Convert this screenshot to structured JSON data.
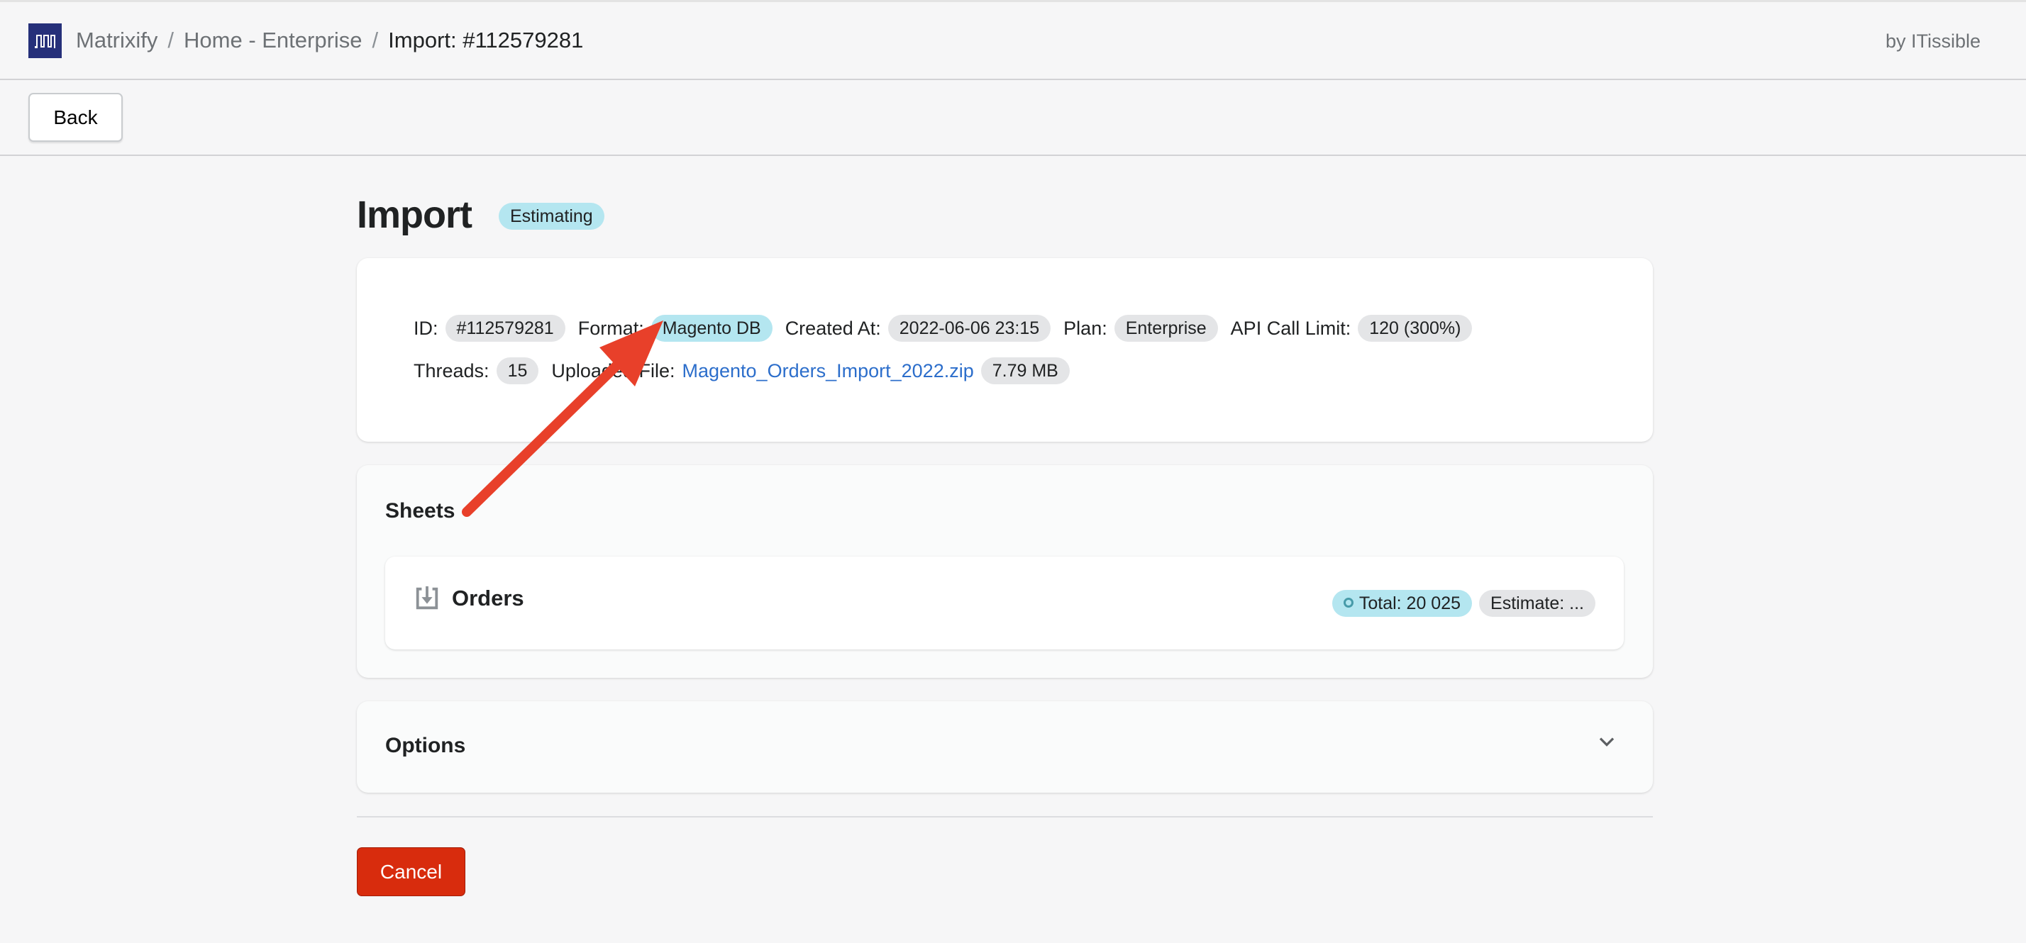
{
  "header": {
    "breadcrumb": [
      "Matrixify",
      "Home - Enterprise",
      "Import: #112579281"
    ],
    "by": "by ITissible"
  },
  "toolbar": {
    "back_label": "Back"
  },
  "page": {
    "title": "Import",
    "status": "Estimating"
  },
  "details": {
    "id_label": "ID:",
    "id": "#112579281",
    "format_label": "Format:",
    "format": "Magento DB",
    "created_label": "Created At:",
    "created": "2022-06-06 23:15",
    "plan_label": "Plan:",
    "plan": "Enterprise",
    "api_label": "API Call Limit:",
    "api": "120 (300%)",
    "threads_label": "Threads:",
    "threads": "15",
    "file_label": "Uploaded File:",
    "file": "Magento_Orders_Import_2022.zip",
    "size": "7.79 MB"
  },
  "sheets": {
    "title": "Sheets",
    "items": [
      {
        "name": "Orders",
        "total": "Total: 20 025",
        "estimate": "Estimate: ..."
      }
    ]
  },
  "options": {
    "title": "Options"
  },
  "actions": {
    "cancel_label": "Cancel"
  },
  "colors": {
    "logo": "#26307a",
    "info_badge": "#b4e6f0",
    "cancel": "#d82c0d",
    "link": "#2c6ecb",
    "annotation_arrow": "#e8402a"
  }
}
